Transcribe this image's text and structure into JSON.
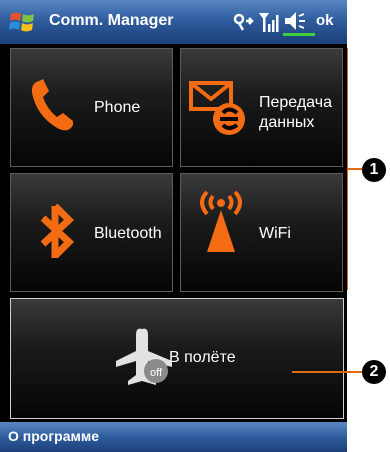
{
  "titlebar": {
    "title": "Comm. Manager",
    "ok_label": "ok"
  },
  "tiles": [
    {
      "label": "Phone",
      "icon": "phone-icon"
    },
    {
      "label": "Передача данных",
      "line1": "Передача",
      "line2": "данных",
      "icon": "data-transfer-icon"
    },
    {
      "label": "Bluetooth",
      "icon": "bluetooth-icon"
    },
    {
      "label": "WiFi",
      "icon": "wifi-icon"
    }
  ],
  "flight_mode": {
    "label": "В полёте",
    "badge": "off",
    "icon": "airplane-icon"
  },
  "menubar": {
    "left_label": "О программе"
  },
  "callouts": [
    {
      "number": "1"
    },
    {
      "number": "2"
    }
  ],
  "colors": {
    "accent": "#e86a10",
    "titlebar": "#2f5d9e"
  }
}
